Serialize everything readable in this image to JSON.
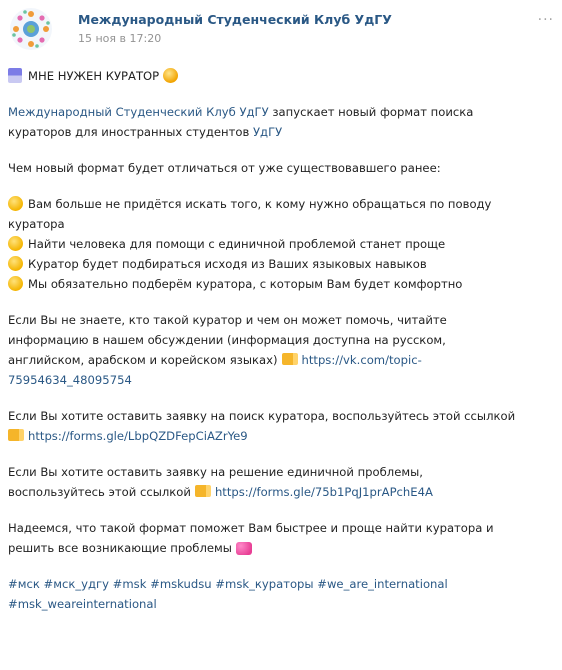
{
  "header": {
    "author": "Международный Студенческий Клуб УдГУ",
    "date": "15 ноя в 17:20",
    "more": "···"
  },
  "post": {
    "title": "МНЕ НУЖЕН КУРАТОР",
    "p1_link": "Международный Студенческий Клуб УдГУ",
    "p1_rest": " запускает новый формат поиска",
    "p1_line2_text": "кураторов для иностранных студентов ",
    "p1_line2_link": "УдГУ",
    "p2": "Чем новый формат будет отличаться от уже существовавшего ранее:",
    "b1_line1": "Вам больше не придётся искать того, к кому нужно обращаться по поводу",
    "b1_line2": "куратора",
    "b2": "Найти человека для помощи с единичной проблемой станет проще",
    "b3": "Куратор будет подбираться исходя из Ваших языковых навыков",
    "b4": "Мы обязательно подберём куратора, с которым Вам будет комфортно",
    "p3_line1": "Если Вы не знаете, кто такой куратор и чем он может помочь, читайте",
    "p3_line2": "информацию в нашем обсуждении (информация доступна на русском,",
    "p3_line3_text": "английском, арабском и корейском языках)",
    "p3_line3_link": "https://vk.com/topic-",
    "p3_line4_link": "75954634_48095754",
    "p4_line1": "Если Вы хотите оставить заявку на поиск куратора, воспользуйтесь этой ссылкой",
    "p4_line2_link": "https://forms.gle/LbpQZDFepCiAZrYe9",
    "p5_line1": "Если Вы хотите оставить заявку на решение единичной проблемы,",
    "p5_line2_text": "воспользуйтесь этой ссылкой",
    "p5_line2_link": "https://forms.gle/75b1PqJ1prAPchE4A",
    "p6_line1": "Надеемся, что такой формат поможет Вам быстрее и проще найти куратора и",
    "p6_line2": "решить все возникающие проблемы",
    "tags_line1": "#мск #мск_удгу #msk #mskudsu #msk_кураторы #we_are_international",
    "tags_line2": "#msk_weareinternational"
  },
  "colors": {
    "link": "#2a5885",
    "date": "#939393"
  }
}
